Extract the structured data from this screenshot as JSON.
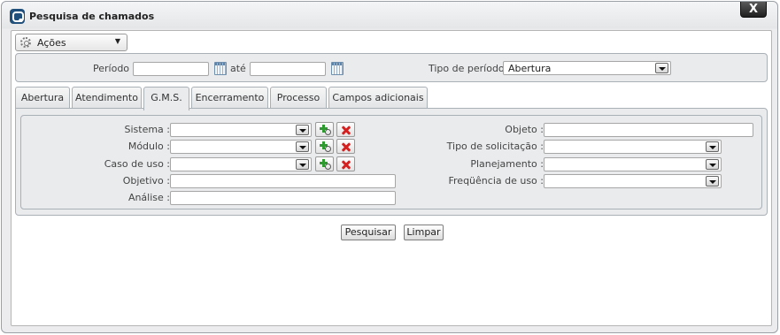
{
  "window": {
    "title": "Pesquisa de chamados",
    "close_label": "X"
  },
  "actions": {
    "label": "Ações"
  },
  "period": {
    "periodo_label": "Período :",
    "ate_label": "até",
    "start_value": "",
    "end_value": "",
    "tipo_label": "Tipo de período :",
    "tipo_value": "Abertura"
  },
  "tabs": [
    {
      "label": "Abertura"
    },
    {
      "label": "Atendimento"
    },
    {
      "label": "G.M.S."
    },
    {
      "label": "Encerramento"
    },
    {
      "label": "Processo"
    },
    {
      "label": "Campos adicionais"
    }
  ],
  "active_tab": "G.M.S.",
  "gms": {
    "sistema_label": "Sistema :",
    "modulo_label": "Módulo :",
    "caso_uso_label": "Caso de uso :",
    "objetivo_label": "Objetivo :",
    "analise_label": "Análise :",
    "objeto_label": "Objeto :",
    "tipo_solicitacao_label": "Tipo de solicitação :",
    "planejamento_label": "Planejamento :",
    "frequencia_label": "Freqüência de uso :"
  },
  "buttons": {
    "search": "Pesquisar",
    "clear": "Limpar"
  },
  "icons": {
    "app": "chat-window-icon",
    "actions": "gear-icon",
    "calendar": "calendar-icon",
    "add": "add-search-icon",
    "delete": "delete-icon",
    "dropdown": "chevron-down-icon"
  }
}
